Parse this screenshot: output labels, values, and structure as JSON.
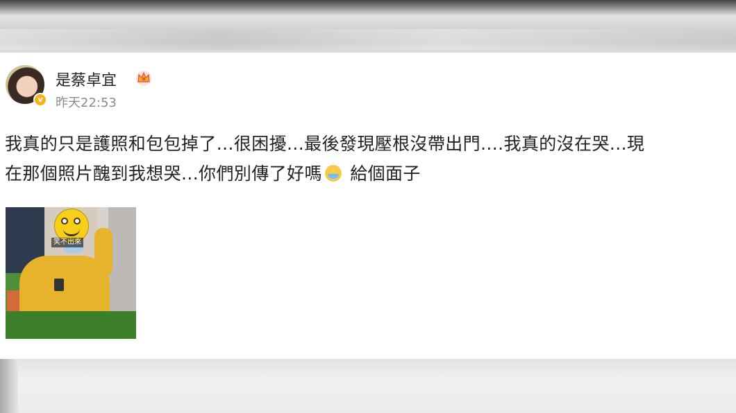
{
  "user": {
    "name": "是蔡卓宜",
    "time": "昨天22:53",
    "verified_icon": "verified-badge-icon",
    "crown_icon": "crown-icon"
  },
  "post": {
    "line1": "我真的只是護照和包包掉了...很困擾...最後發現壓根沒帶出門....我真的沒在哭...現",
    "line2_before": "在那個照片醜到我想哭...你們別傳了好嗎",
    "line2_after": " 給個面子",
    "emoji": "laughing-crying-emoji",
    "photo": {
      "sticker_text": "笑不出來"
    }
  },
  "colors": {
    "username": "#222222",
    "timestamp": "#8a8a8a",
    "body_text": "#222222",
    "badge": "#f7b21a"
  }
}
